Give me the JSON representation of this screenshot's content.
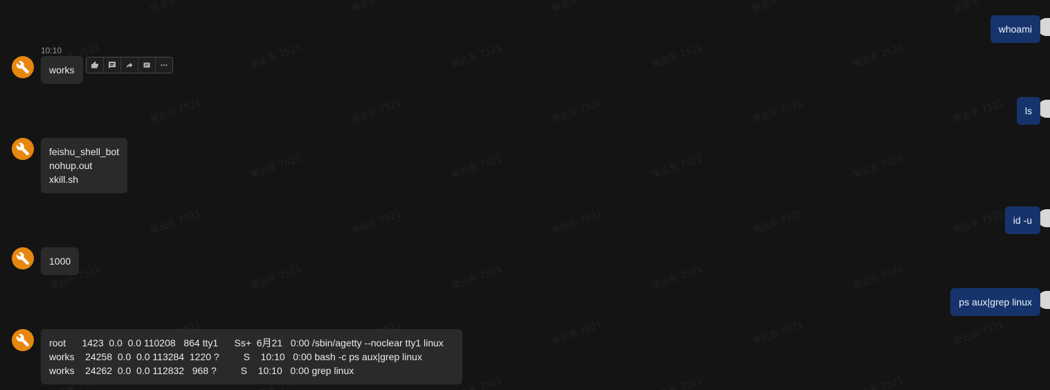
{
  "watermark_text": "荣云东 7521",
  "chat": {
    "first_message_time": "10:10",
    "messages": [
      {
        "sender": "user",
        "text": "whoami"
      },
      {
        "sender": "bot",
        "lines": [
          "works"
        ]
      },
      {
        "sender": "user",
        "text": "ls"
      },
      {
        "sender": "bot",
        "lines": [
          "feishu_shell_bot",
          "nohup.out",
          "xkill.sh"
        ]
      },
      {
        "sender": "user",
        "text": "id -u"
      },
      {
        "sender": "bot",
        "lines": [
          "1000"
        ]
      },
      {
        "sender": "user",
        "text": "ps aux|grep linux"
      },
      {
        "sender": "bot",
        "lines": [
          "root      1423  0.0  0.0 110208   864 tty1      Ss+  6月21   0:00 /sbin/agetty --noclear tty1 linux",
          "works    24258  0.0  0.0 113284  1220 ?         S    10:10   0:00 bash -c ps aux|grep linux",
          "works    24262  0.0  0.0 112832   968 ?         S    10:10   0:00 grep linux"
        ]
      }
    ]
  },
  "toolbar": {
    "buttons": [
      "thumbs-up-icon",
      "reply-icon",
      "forward-icon",
      "flag-icon",
      "more-icon"
    ]
  },
  "colors": {
    "background": "#141414",
    "bot_bubble": "#2a2a2a",
    "user_bubble": "#16346b",
    "bot_avatar": "#e8870f"
  }
}
